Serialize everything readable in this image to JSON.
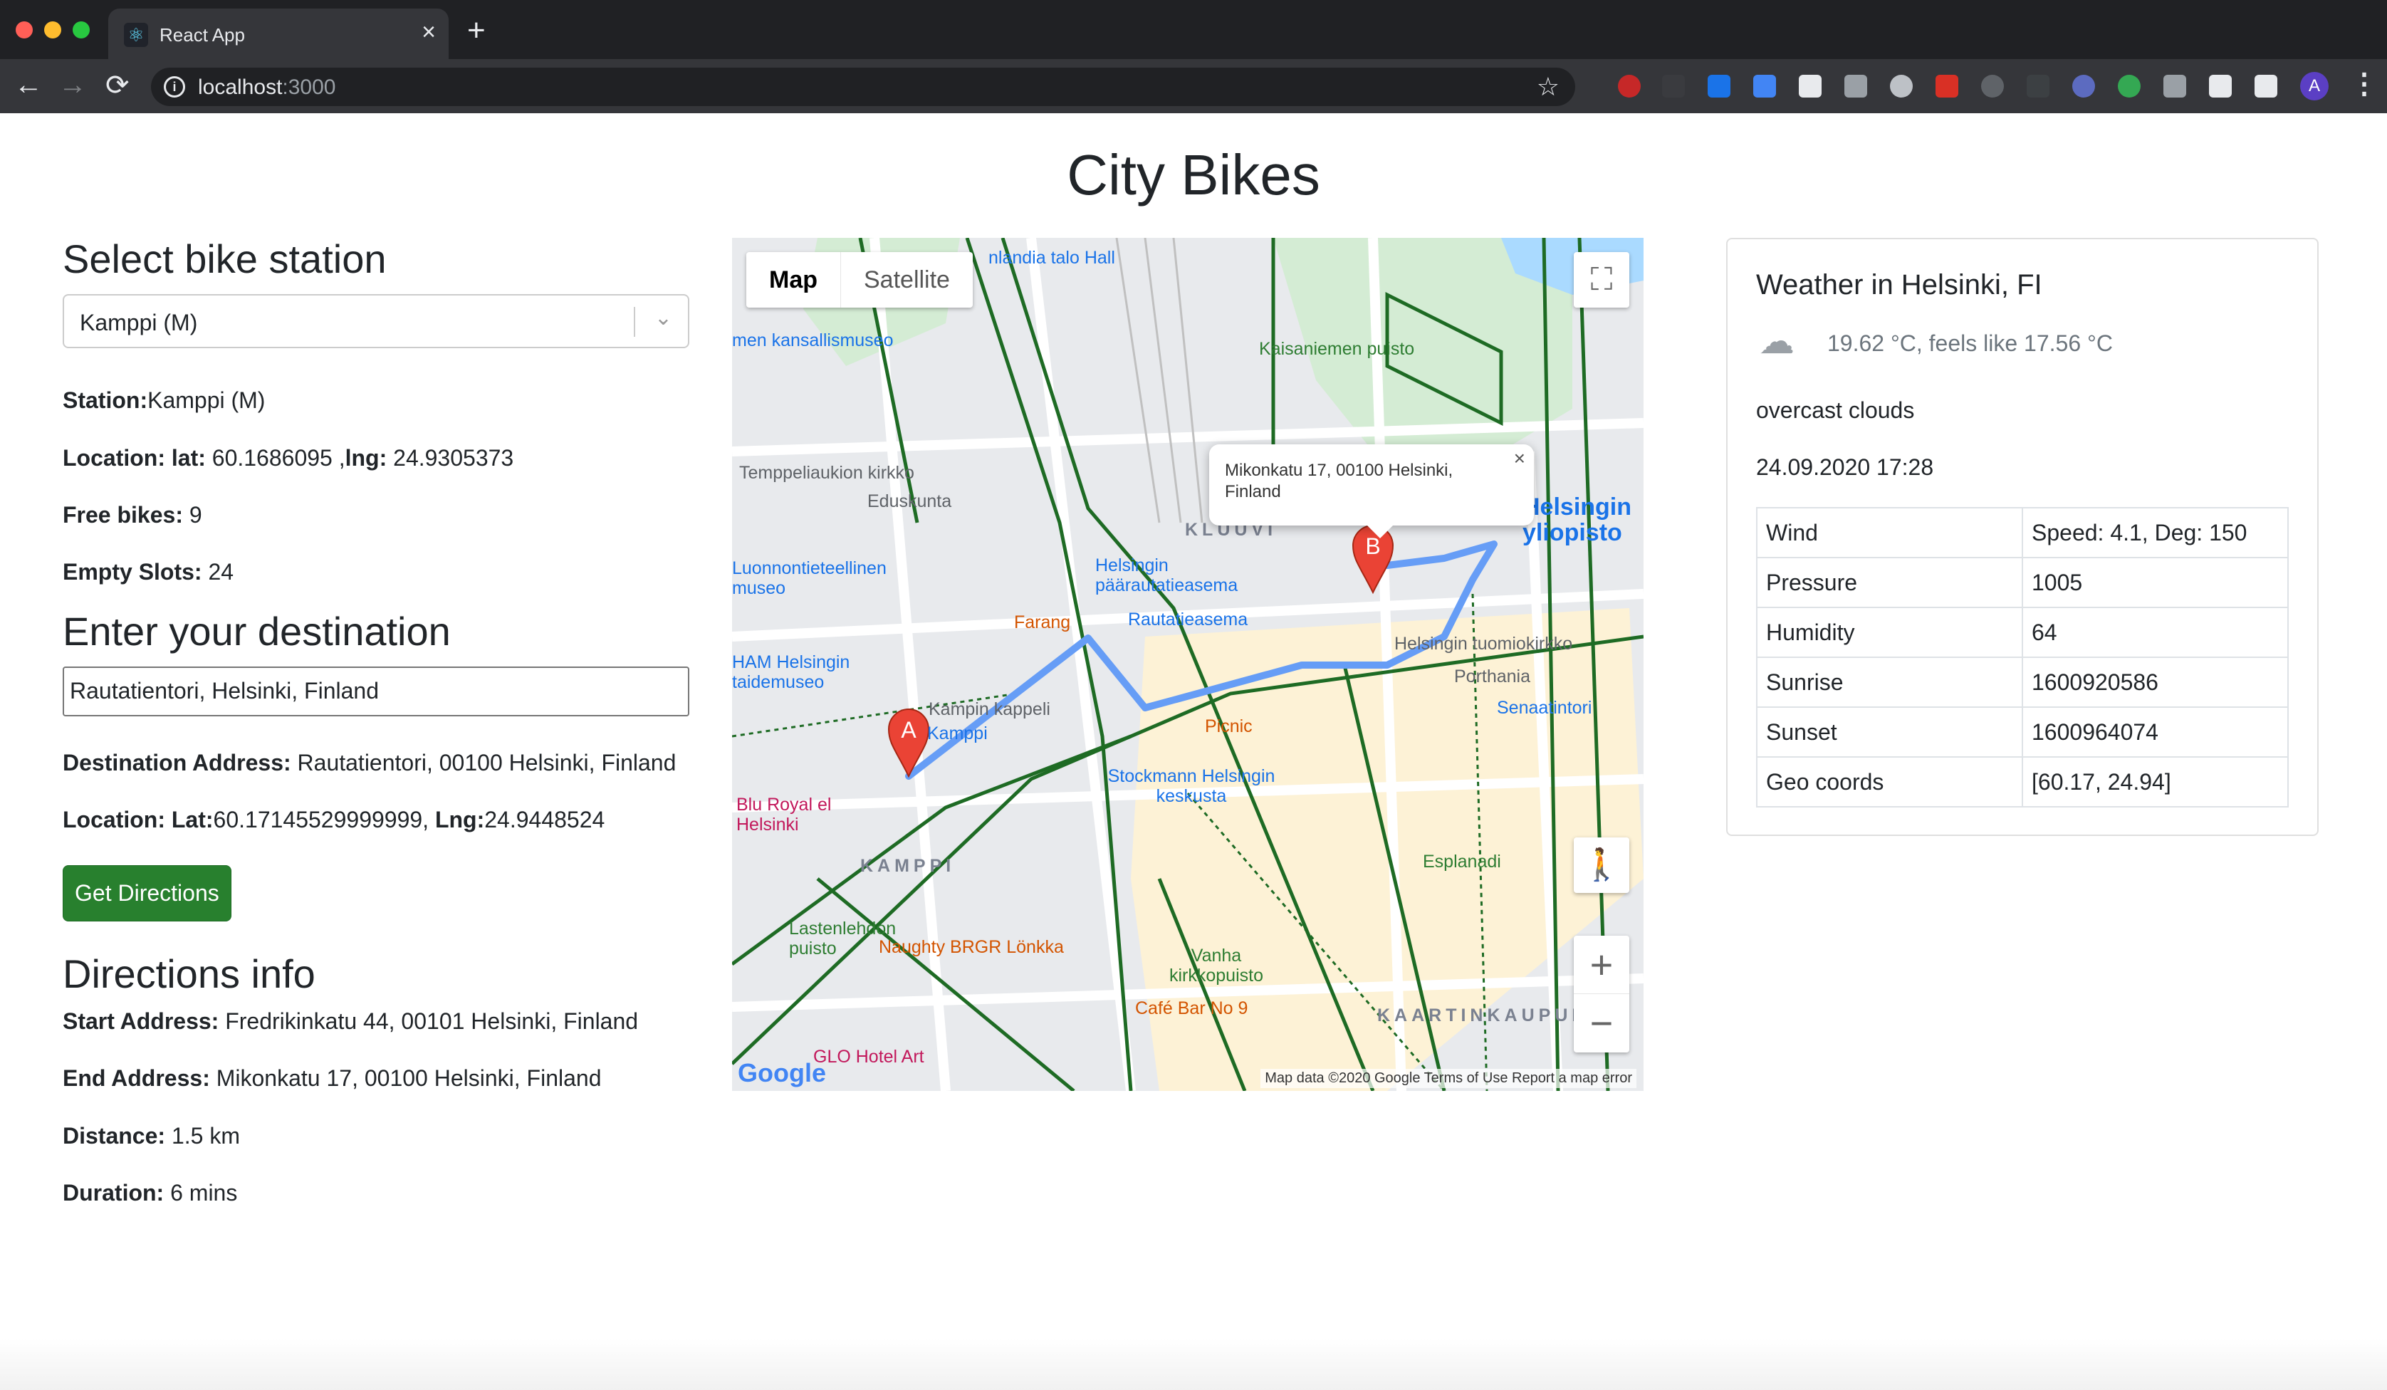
{
  "browser": {
    "tab_title": "React App",
    "tab_close": "×",
    "new_tab": "+",
    "url_host": "localhost",
    "url_port": ":3000",
    "back": "←",
    "forward": "→",
    "reload": "⟳",
    "info": "i",
    "star": "☆",
    "profile_initial": "A",
    "menu": "⋮",
    "favicon": "⚛"
  },
  "page": {
    "title": "City Bikes"
  },
  "station": {
    "heading": "Select bike station",
    "selected": "Kamppi (M)",
    "station_label": "Station:",
    "station_value": "Kamppi (M)",
    "location_label": "Location: lat:",
    "location_value": " 60.1686095 ,",
    "lng_label": "lng:",
    "lng_value": " 24.9305373",
    "free_label": "Free bikes:",
    "free_value": " 9",
    "empty_label": "Empty Slots:",
    "empty_value": " 24"
  },
  "destination": {
    "heading": "Enter your destination",
    "input_value": "Rautatientori, Helsinki, Finland",
    "address_label": "Destination Address:",
    "address_value": " Rautatientori, 00100 Helsinki, Finland",
    "location_label": "Location: Lat:",
    "lat_value": "60.17145529999999,",
    "lng_label": " Lng:",
    "lng_value": "24.9448524",
    "button": "Get Directions"
  },
  "directions": {
    "heading": "Directions info",
    "start_label": "Start Address:",
    "start_value": " Fredrikinkatu 44, 00101 Helsinki, Finland",
    "end_label": "End Address:",
    "end_value": " Mikonkatu 17, 00100 Helsinki, Finland",
    "distance_label": "Distance:",
    "distance_value": " 1.5 km",
    "duration_label": "Duration:",
    "duration_value": " 6 mins"
  },
  "map": {
    "type_map": "Map",
    "type_satellite": "Satellite",
    "fullscreen": "⛶",
    "pegman": "🚶",
    "zoom_in": "+",
    "zoom_out": "−",
    "infowindow_text": "Mikonkatu 17, 00100 Helsinki, Finland",
    "infowindow_close": "×",
    "marker_a": "A",
    "marker_b": "B",
    "google": "Google",
    "footer": "Map data ©2020 Google     Terms of Use     Report a map error",
    "labels": [
      "nlandia talo Hall",
      "men kansallismuseo",
      "Kaisaniemen puisto",
      "Temppeliaukion kirkko",
      "Eduskunta",
      "KLUUVI",
      "Helsingin yliopisto",
      "Luonnontieteellinen museo",
      "Helsingin päärautatieasema",
      "Farang",
      "Rautatieasema",
      "HAM Helsingin taidemuseo",
      "Helsingin tuomiokirkko",
      "Porthania",
      "Kampin kappeli",
      "Kamppi",
      "Senaatintori",
      "Picnic",
      "Blu Royal el Helsinki",
      "Stockmann Helsingin keskusta",
      "KAMPPI",
      "Esplanadi",
      "Lastenlehdon puisto",
      "Naughty BRGR Lönkka",
      "Vanha kirkkopuisto",
      "Café Bar No 9",
      "KAARTINKAUPUNKI",
      "GLO Hotel Art"
    ]
  },
  "weather": {
    "title": "Weather in Helsinki, FI",
    "icon": "cloud-icon",
    "icon_glyph": "☁",
    "temp": "19.62 °C, feels like 17.56 °C",
    "description": "overcast clouds",
    "datetime": "24.09.2020 17:28",
    "rows": [
      {
        "label": "Wind",
        "value": "Speed: 4.1, Deg: 150"
      },
      {
        "label": "Pressure",
        "value": "1005"
      },
      {
        "label": "Humidity",
        "value": "64"
      },
      {
        "label": "Sunrise",
        "value": "1600920586"
      },
      {
        "label": "Sunset",
        "value": "1600964074"
      },
      {
        "label": "Geo coords",
        "value": "[60.17, 24.94]"
      }
    ]
  },
  "colors": {
    "button": "#28802e",
    "route": "#669df6",
    "marker": "#ea4335",
    "bike_path": "#1e6b24"
  }
}
